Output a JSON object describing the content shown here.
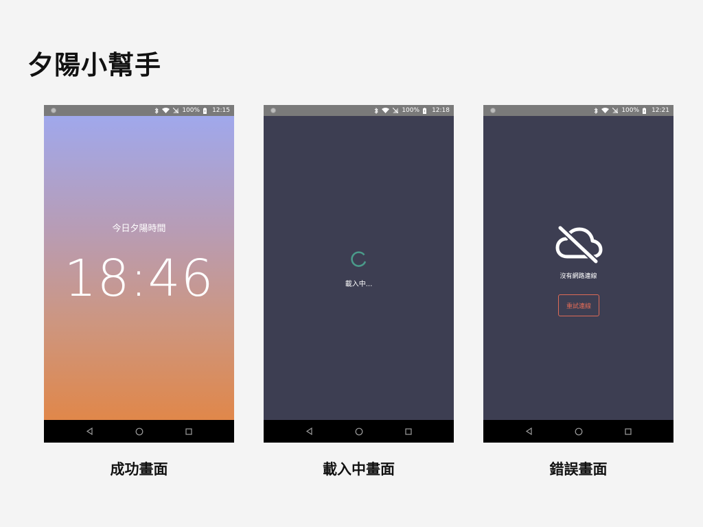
{
  "page": {
    "title": "夕陽小幫手"
  },
  "screens": [
    {
      "caption": "成功畫面",
      "status": {
        "battery": "100%",
        "time": "12:15"
      },
      "label": "今日夕陽時間",
      "sunset_time": "18:46"
    },
    {
      "caption": "載入中畫面",
      "status": {
        "battery": "100%",
        "time": "12:18"
      },
      "loading_text": "載入中..."
    },
    {
      "caption": "錯誤畫面",
      "status": {
        "battery": "100%",
        "time": "12:21"
      },
      "error_text": "沒有網路連線",
      "retry_label": "重試連線"
    }
  ],
  "icons": {
    "status_left": "notification-dot-icon",
    "status_right": [
      "bluetooth-icon",
      "wifi-icon",
      "no-sim-icon",
      "battery-icon"
    ],
    "nav": [
      "back-icon",
      "home-icon",
      "recents-icon"
    ],
    "loading": "spinner-icon",
    "error": "cloud-off-icon"
  },
  "colors": {
    "page_background": "#f4f4f4",
    "status_bar": "#7a7a7a",
    "dark_screen": "#3d3e52",
    "gradient_top": "#a0a8ec",
    "gradient_bottom": "#e0874a",
    "spinner": "#4a9a8a",
    "retry_accent": "#e06b57",
    "nav_bar": "#000000"
  }
}
